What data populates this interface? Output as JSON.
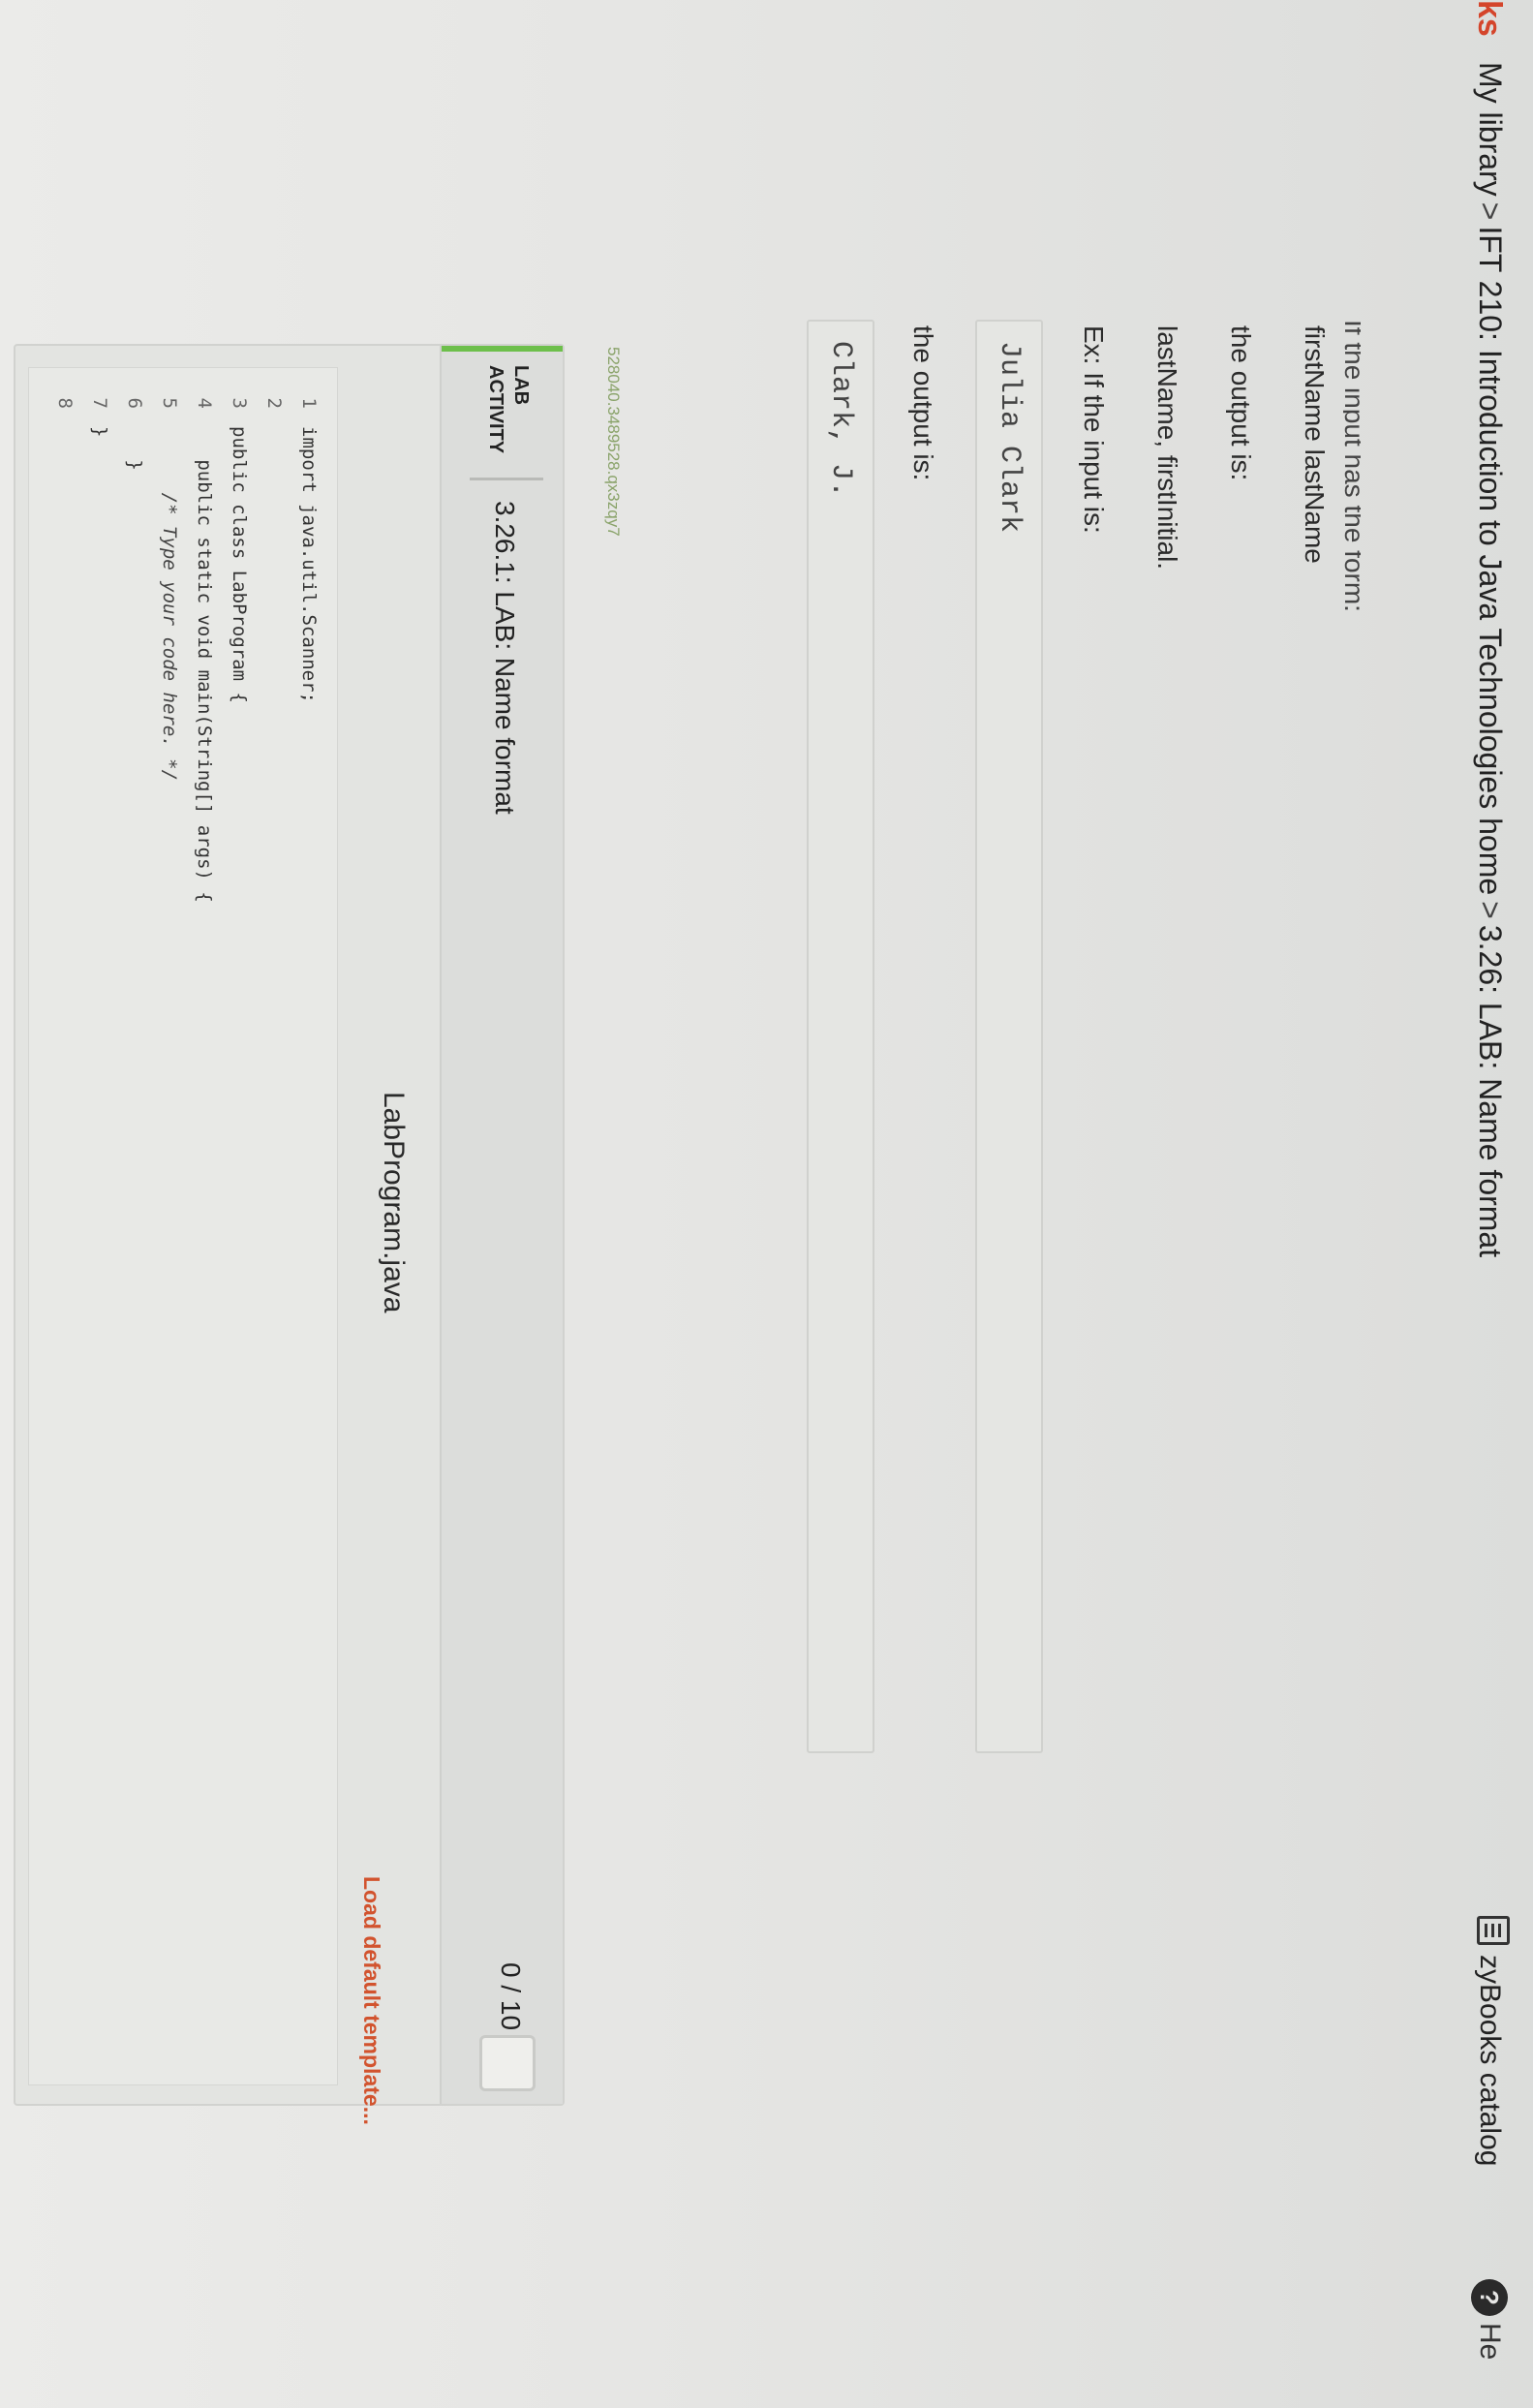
{
  "header": {
    "logo": "ks",
    "breadcrumb": [
      "My library",
      "IFT 210: Introduction to Java Technologies home",
      "3.26: LAB: Name format"
    ],
    "separator": ">",
    "catalog_label": "zyBooks catalog",
    "help_label": "He",
    "help_glyph": "?"
  },
  "instructions": {
    "cut_line": "If the input has the form:",
    "form_line": "firstName lastName",
    "output_is_1": "the output is:",
    "output_form": "lastName, firstInitial.",
    "example_intro": "Ex: If the input is:",
    "example_input": "Julia Clark",
    "output_is_2": "the output is:",
    "example_output": "Clark, J."
  },
  "lab": {
    "code": "528040.3489528.qx3zqy7",
    "tag": "LAB ACTIVITY",
    "title": "3.26.1: LAB: Name format",
    "score": "0 / 10",
    "file_name": "LabProgram.java",
    "load_default": "Load default template..."
  },
  "editor": {
    "lines": [
      {
        "num": "1",
        "text": "import java.util.Scanner;"
      },
      {
        "num": "2",
        "text": ""
      },
      {
        "num": "3",
        "text": "public class LabProgram {"
      },
      {
        "num": "4",
        "text": "   public static void main(String[] args) {"
      },
      {
        "num": "5",
        "text": "      /* Type your code here. */"
      },
      {
        "num": "6",
        "text": "   }"
      },
      {
        "num": "7",
        "text": "}"
      },
      {
        "num": "8",
        "text": ""
      }
    ]
  }
}
